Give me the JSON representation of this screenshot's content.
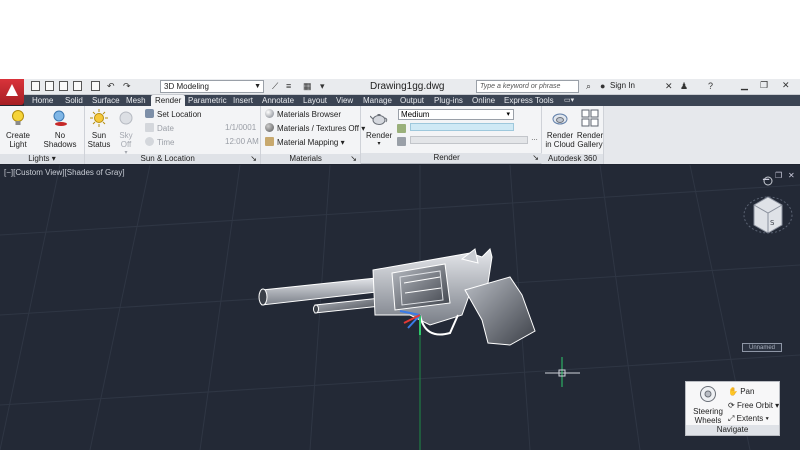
{
  "titlebar": {
    "workspace": "3D Modeling",
    "document_title": "Drawing1gg.dwg",
    "search_placeholder": "Type a keyword or phrase",
    "signin": "Sign In"
  },
  "tabs": [
    {
      "label": "Home"
    },
    {
      "label": "Solid"
    },
    {
      "label": "Surface"
    },
    {
      "label": "Mesh"
    },
    {
      "label": "Render",
      "active": true
    },
    {
      "label": "Parametric"
    },
    {
      "label": "Insert"
    },
    {
      "label": "Annotate"
    },
    {
      "label": "Layout"
    },
    {
      "label": "View"
    },
    {
      "label": "Manage"
    },
    {
      "label": "Output"
    },
    {
      "label": "Plug-ins"
    },
    {
      "label": "Online"
    },
    {
      "label": "Express Tools"
    }
  ],
  "ribbon": {
    "lights": {
      "title": "Lights",
      "create_light": "Create Light",
      "no_shadows": "No Shadows"
    },
    "sun": {
      "title": "Sun & Location",
      "sun_status": "Sun Status",
      "sky_off": "Sky Off",
      "set_location": "Set Location",
      "date_label": "Date",
      "date_value": "1/1/0001",
      "time_label": "Time",
      "time_value": "12:00 AM"
    },
    "materials": {
      "title": "Materials",
      "browser": "Materials Browser",
      "textures": "Materials / Textures Off",
      "mapping": "Material Mapping"
    },
    "render": {
      "title": "Render",
      "render_btn": "Render",
      "quality": "Medium"
    },
    "autodesk360": {
      "title": "Autodesk 360",
      "cloud": "Render in Cloud",
      "gallery": "Render Gallery"
    }
  },
  "viewport": {
    "label": "[−][Custom View][Shades of Gray]",
    "viewcube_face": "S",
    "unnamed": "Unnamed"
  },
  "navigate": {
    "title": "Navigate",
    "steering": "Steering Wheels",
    "pan": "Pan",
    "free_orbit": "Free Orbit",
    "extents": "Extents"
  },
  "colors": {
    "accent_red": "#c8262e",
    "viewport_bg": "#232936",
    "ribbon_bg": "#f3f4f6",
    "tab_bar_bg": "#3b4453"
  }
}
